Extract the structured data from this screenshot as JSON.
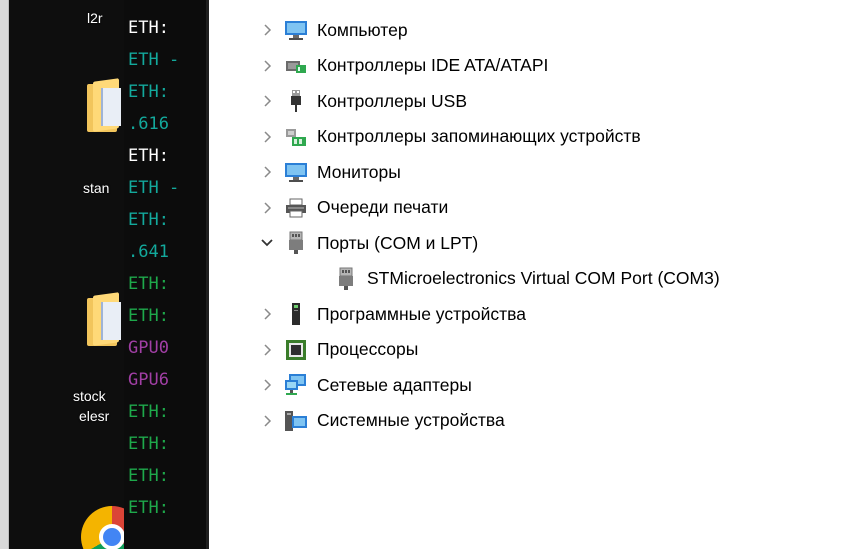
{
  "desktop": {
    "labels": [
      "l2r",
      "stan",
      "stock",
      "elesr"
    ],
    "icons": [
      "folder-icon",
      "folder-icon",
      "chrome-icon"
    ]
  },
  "terminal": {
    "lines": [
      {
        "text": "ETH:",
        "color": "#ffffff"
      },
      {
        "text": "ETH -",
        "color": "#13a99c"
      },
      {
        "text": "ETH:",
        "color": "#13a99c"
      },
      {
        "text": ".616",
        "color": "#13a99c"
      },
      {
        "text": "ETH:",
        "color": "#ffffff"
      },
      {
        "text": "ETH -",
        "color": "#13a99c"
      },
      {
        "text": "ETH:",
        "color": "#13a99c"
      },
      {
        "text": ".641",
        "color": "#13a99c"
      },
      {
        "text": "ETH:",
        "color": "#1ea94b"
      },
      {
        "text": "ETH:",
        "color": "#1ea94b"
      },
      {
        "text": "GPU0",
        "color": "#a13fa5"
      },
      {
        "text": "GPU6",
        "color": "#a13fa5"
      },
      {
        "text": "ETH:",
        "color": "#1ea94b"
      },
      {
        "text": "ETH:",
        "color": "#1ea94b"
      },
      {
        "text": "ETH:",
        "color": "#1ea94b"
      },
      {
        "text": "ETH:",
        "color": "#1ea94b"
      }
    ]
  },
  "device_tree": {
    "items": [
      {
        "label": "Компьютер",
        "icon": "computer-icon",
        "state": "collapsed",
        "level": 0
      },
      {
        "label": "Контроллеры IDE ATA/ATAPI",
        "icon": "ide-controller-icon",
        "state": "collapsed",
        "level": 0
      },
      {
        "label": "Контроллеры USB",
        "icon": "usb-icon",
        "state": "collapsed",
        "level": 0
      },
      {
        "label": "Контроллеры запоминающих устройств",
        "icon": "storage-controller-icon",
        "state": "collapsed",
        "level": 0
      },
      {
        "label": "Мониторы",
        "icon": "monitor-icon",
        "state": "collapsed",
        "level": 0
      },
      {
        "label": "Очереди печати",
        "icon": "printer-icon",
        "state": "collapsed",
        "level": 0
      },
      {
        "label": "Порты (COM и LPT)",
        "icon": "port-icon",
        "state": "expanded",
        "level": 0
      },
      {
        "label": "STMicroelectronics Virtual COM Port (COM3)",
        "icon": "port-icon",
        "state": "leaf",
        "level": 1
      },
      {
        "label": "Программные устройства",
        "icon": "software-device-icon",
        "state": "collapsed",
        "level": 0
      },
      {
        "label": "Процессоры",
        "icon": "processor-icon",
        "state": "collapsed",
        "level": 0
      },
      {
        "label": "Сетевые адаптеры",
        "icon": "network-adapter-icon",
        "state": "collapsed",
        "level": 0
      },
      {
        "label": "Системные устройства",
        "icon": "system-devices-icon",
        "state": "collapsed",
        "level": 0
      }
    ]
  }
}
